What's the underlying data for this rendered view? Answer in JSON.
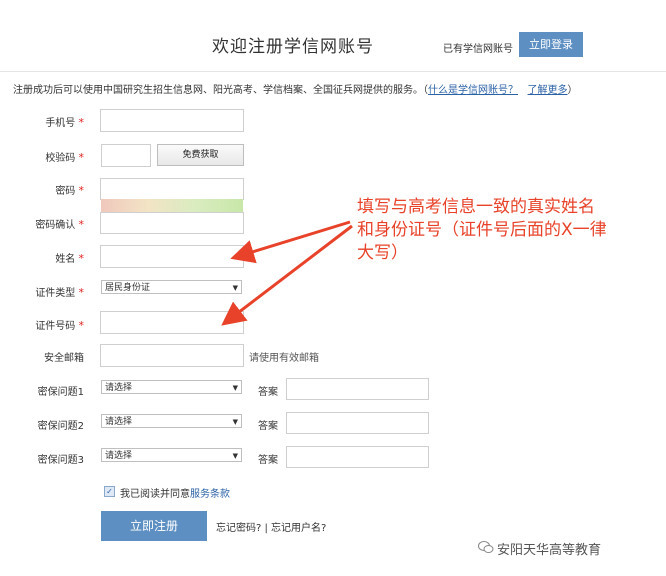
{
  "header": {
    "title": "欢迎注册学信网账号",
    "has_account": "已有学信网账号",
    "login_button": "立即登录"
  },
  "notice": {
    "text": "注册成功后可以使用中国研究生招生信息网、阳光高考、学信档案、全国征兵网提供的服务。（",
    "link1": "什么是学信网账号？",
    "link2": "了解更多",
    "close": "）"
  },
  "form": {
    "phone_label": "手机号",
    "code_label": "校验码",
    "get_code_button": "免费获取",
    "password_label": "密码",
    "confirm_label": "密码确认",
    "name_label": "姓名",
    "id_type_label": "证件类型",
    "id_type_value": "居民身份证",
    "id_number_label": "证件号码",
    "email_label": "安全邮箱",
    "email_hint": "请使用有效邮箱",
    "q1_label": "密保问题1",
    "q2_label": "密保问题2",
    "q3_label": "密保问题3",
    "select_placeholder": "请选择",
    "answer_label": "答案",
    "required_mark": "*"
  },
  "agree": {
    "text": "我已阅读并同意",
    "link": "服务条款"
  },
  "submit_button": "立即注册",
  "forgot_text": "忘记密码? | 忘记用户名?",
  "annotation": {
    "line1": "填写与高考信息一致的真实姓名",
    "line2": "和身份证号（证件号后面的X一律",
    "line3": "大写）"
  },
  "watermark": "安阳天华高等教育",
  "colors": {
    "accent": "#5d8fc2",
    "required": "#e0201e",
    "annotation": "#e8432a",
    "link": "#2b62a6"
  }
}
